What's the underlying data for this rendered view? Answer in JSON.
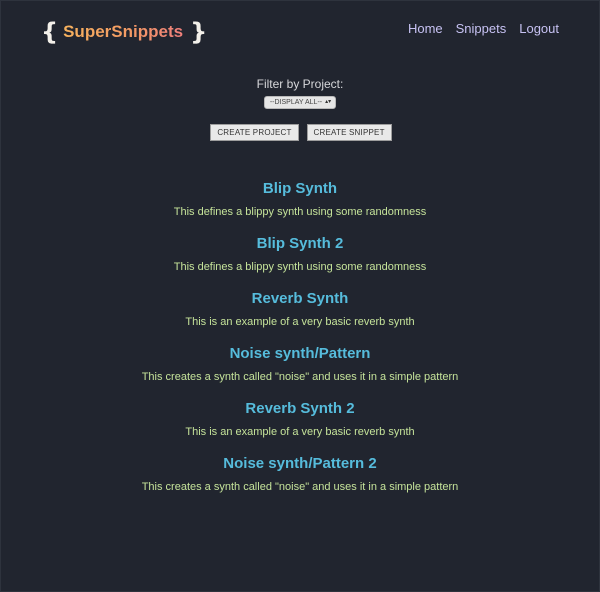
{
  "header": {
    "brace_open": "{",
    "brand": "SuperSnippets",
    "brace_close": "}",
    "nav": [
      "Home",
      "Snippets",
      "Logout"
    ]
  },
  "filter": {
    "label": "Filter by Project:",
    "selected": "--DISPLAY ALL--"
  },
  "actions": {
    "create_project": "CREATE PROJECT",
    "create_snippet": "CREATE SNIPPET"
  },
  "snippets": [
    {
      "title": "Blip Synth",
      "description": "This defines a blippy synth using some randomness"
    },
    {
      "title": "Blip Synth 2",
      "description": "This defines a blippy synth using some randomness"
    },
    {
      "title": "Reverb Synth",
      "description": "This is an example of a very basic reverb synth"
    },
    {
      "title": "Noise synth/Pattern",
      "description": "This creates a synth called \"noise\" and uses it in a simple pattern"
    },
    {
      "title": "Reverb Synth 2",
      "description": "This is an example of a very basic reverb synth"
    },
    {
      "title": "Noise synth/Pattern 2",
      "description": "This creates a synth called \"noise\" and uses it in a simple pattern"
    }
  ],
  "colors": {
    "background": "#21252f",
    "snippet_title": "#56bcdc",
    "snippet_description": "#c5e39a",
    "nav_link": "#c7c2f3",
    "brand_gradient_start": "#f6b25e",
    "brand_gradient_end": "#ef7f7c"
  }
}
